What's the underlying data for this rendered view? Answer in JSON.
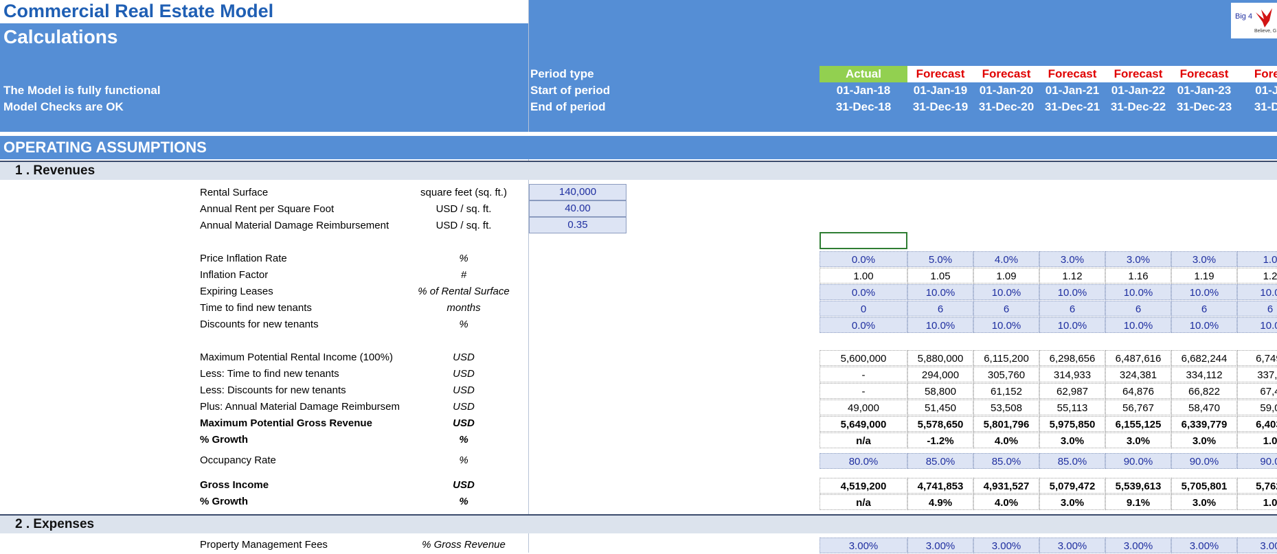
{
  "header": {
    "title": "Commercial Real Estate Model",
    "subtitle": "Calculations",
    "status_lines": [
      "The Model is fully functional",
      "Model Checks are OK"
    ],
    "row_labels": [
      "Period type",
      "Start of period",
      "End of period"
    ],
    "logo_text": "Big 4",
    "logo_subtext": "Believe, G"
  },
  "periods": [
    {
      "type": "Actual",
      "start": "01-Jan-18",
      "end": "31-Dec-18"
    },
    {
      "type": "Forecast",
      "start": "01-Jan-19",
      "end": "31-Dec-19"
    },
    {
      "type": "Forecast",
      "start": "01-Jan-20",
      "end": "31-Dec-20"
    },
    {
      "type": "Forecast",
      "start": "01-Jan-21",
      "end": "31-Dec-21"
    },
    {
      "type": "Forecast",
      "start": "01-Jan-22",
      "end": "31-Dec-22"
    },
    {
      "type": "Forecast",
      "start": "01-Jan-23",
      "end": "31-Dec-23"
    },
    {
      "type": "Forec",
      "start": "01-Ja",
      "end": "31-De"
    }
  ],
  "section_title": "OPERATING ASSUMPTIONS",
  "revenues": {
    "heading": "1 . Revenues",
    "inputs": [
      {
        "label": "Rental Surface",
        "unit": "square feet (sq. ft.)",
        "value": "140,000"
      },
      {
        "label": "Annual Rent per Square Foot",
        "unit": "USD / sq. ft.",
        "value": "40.00"
      },
      {
        "label": "Annual Material Damage Reimbursement",
        "unit": "USD / sq. ft.",
        "value": "0.35"
      }
    ],
    "rows": [
      {
        "label": "Price Inflation Rate",
        "unit": "%",
        "style": "blue",
        "bold": false,
        "values": [
          "0.0%",
          "5.0%",
          "4.0%",
          "3.0%",
          "3.0%",
          "3.0%",
          "1.0"
        ]
      },
      {
        "label": "Inflation Factor",
        "unit": "#",
        "style": "plain",
        "bold": false,
        "values": [
          "1.00",
          "1.05",
          "1.09",
          "1.12",
          "1.16",
          "1.19",
          "1.2"
        ]
      },
      {
        "label": "Expiring Leases",
        "unit": "% of Rental Surface",
        "style": "blue",
        "bold": false,
        "values": [
          "0.0%",
          "10.0%",
          "10.0%",
          "10.0%",
          "10.0%",
          "10.0%",
          "10.0"
        ]
      },
      {
        "label": "Time to find new tenants",
        "unit": "months",
        "style": "blue",
        "bold": false,
        "values": [
          "0",
          "6",
          "6",
          "6",
          "6",
          "6",
          "6"
        ]
      },
      {
        "label": "Discounts for new tenants",
        "unit": "%",
        "style": "blue",
        "bold": false,
        "values": [
          "0.0%",
          "10.0%",
          "10.0%",
          "10.0%",
          "10.0%",
          "10.0%",
          "10.0"
        ]
      },
      {
        "label": "Maximum Potential Rental Income (100%)",
        "unit": "USD",
        "style": "plain",
        "bold": false,
        "values": [
          "5,600,000",
          "5,880,000",
          "6,115,200",
          "6,298,656",
          "6,487,616",
          "6,682,244",
          "6,749,"
        ]
      },
      {
        "label": "Less: Time to find new tenants",
        "unit": "USD",
        "style": "plain",
        "bold": false,
        "values": [
          "-",
          "294,000",
          "305,760",
          "314,933",
          "324,381",
          "334,112",
          "337,4"
        ]
      },
      {
        "label": "Less: Discounts for new tenants",
        "unit": "USD",
        "style": "plain",
        "bold": false,
        "values": [
          "-",
          "58,800",
          "61,152",
          "62,987",
          "64,876",
          "66,822",
          "67,4"
        ]
      },
      {
        "label": "Plus: Annual Material Damage Reimbursem",
        "unit": "USD",
        "style": "plain",
        "bold": false,
        "values": [
          "49,000",
          "51,450",
          "53,508",
          "55,113",
          "56,767",
          "58,470",
          "59,0"
        ]
      },
      {
        "label": "Maximum Potential Gross Revenue",
        "unit": "USD",
        "style": "plain",
        "bold": true,
        "values": [
          "5,649,000",
          "5,578,650",
          "5,801,796",
          "5,975,850",
          "6,155,125",
          "6,339,779",
          "6,403,"
        ]
      },
      {
        "label": "% Growth",
        "unit": "%",
        "style": "plain",
        "bold": true,
        "values": [
          "n/a",
          "-1.2%",
          "4.0%",
          "3.0%",
          "3.0%",
          "3.0%",
          "1.0"
        ]
      },
      {
        "label": "Occupancy Rate",
        "unit": "%",
        "style": "blue",
        "bold": false,
        "values": [
          "80.0%",
          "85.0%",
          "85.0%",
          "85.0%",
          "90.0%",
          "90.0%",
          "90.0"
        ]
      },
      {
        "label": "Gross Income",
        "unit": "USD",
        "style": "plain",
        "bold": true,
        "values": [
          "4,519,200",
          "4,741,853",
          "4,931,527",
          "5,079,472",
          "5,539,613",
          "5,705,801",
          "5,762,"
        ]
      },
      {
        "label": "% Growth",
        "unit": "%",
        "style": "plain",
        "bold": true,
        "values": [
          "n/a",
          "4.9%",
          "4.0%",
          "3.0%",
          "9.1%",
          "3.0%",
          "1.0"
        ]
      }
    ]
  },
  "expenses": {
    "heading": "2 . Expenses",
    "rows": [
      {
        "label": "Property Management Fees",
        "unit": "% Gross Revenue",
        "style": "blue",
        "bold": false,
        "values": [
          "3.00%",
          "3.00%",
          "3.00%",
          "3.00%",
          "3.00%",
          "3.00%",
          "3.00"
        ]
      }
    ]
  },
  "colors": {
    "header_bg": "#558ed5",
    "actual": "#92d050",
    "forecast_text": "#e00000",
    "input_bg": "#dde4f4",
    "input_text": "#1f2fa0"
  }
}
